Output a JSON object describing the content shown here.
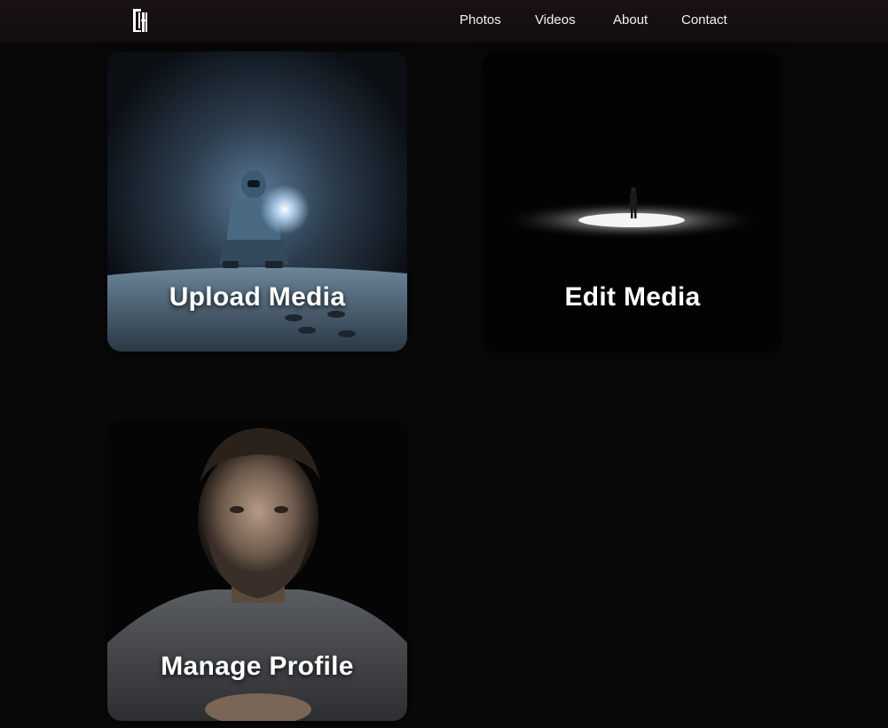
{
  "nav": {
    "logo_icon": "monogram-logo-icon",
    "links": [
      {
        "label": "Photos"
      },
      {
        "label": "Videos"
      },
      {
        "label": "About"
      },
      {
        "label": "Contact"
      }
    ]
  },
  "cards": [
    {
      "title": "Upload Media",
      "image": "person-crouching-with-flashlight-in-snow"
    },
    {
      "title": "Edit Media",
      "image": "lone-figure-in-spotlight-dark"
    },
    {
      "title": "Manage Profile",
      "image": "bearded-man-portrait-dark"
    }
  ],
  "colors": {
    "background": "#090909",
    "navbar": "#150f0f",
    "text": "#ffffff"
  }
}
